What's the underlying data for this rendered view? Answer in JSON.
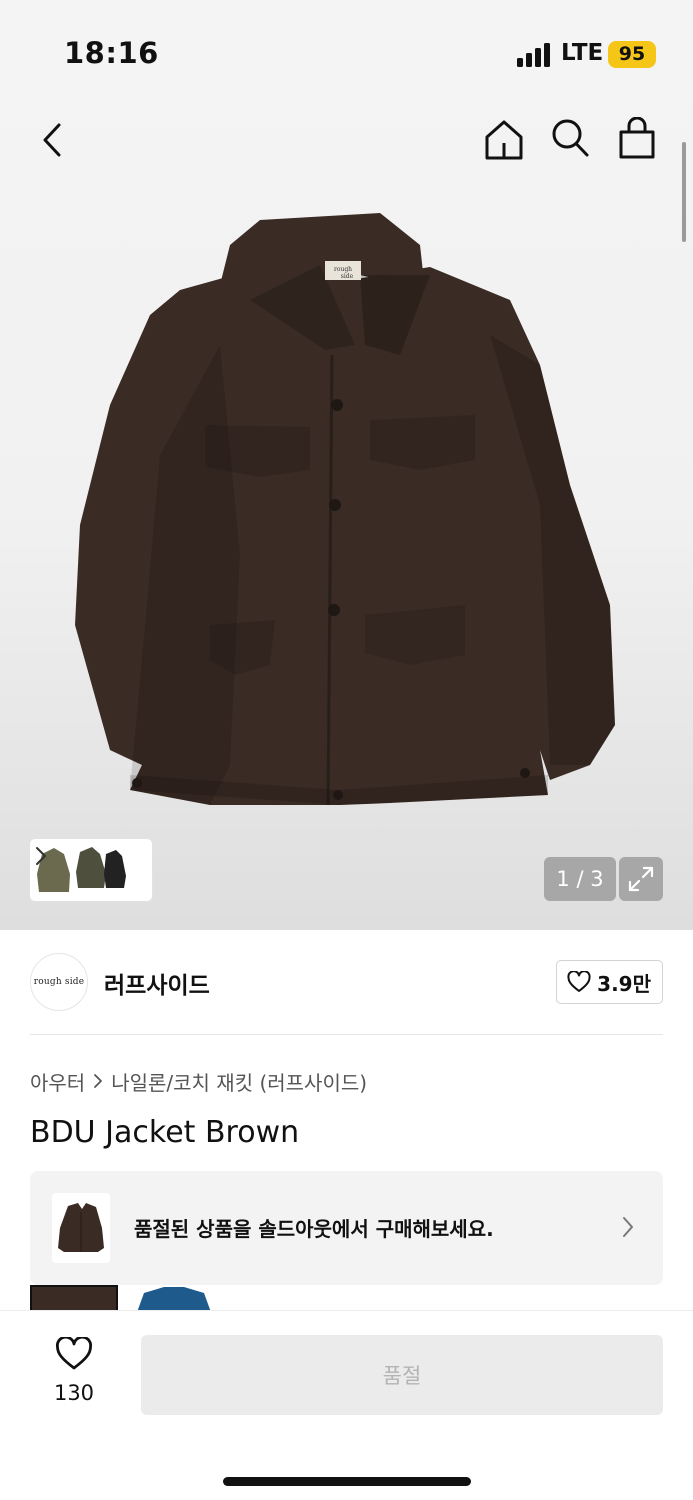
{
  "status_bar": {
    "time": "18:16",
    "network": "LTE",
    "battery": "95",
    "battery_color": "#f5c518"
  },
  "nav": {
    "back_icon": "chevron-left-icon",
    "home_icon": "home-icon",
    "search_icon": "search-icon",
    "bag_icon": "shopping-bag-icon"
  },
  "gallery": {
    "counter": "1 / 3",
    "jacket_color": "#3a2b24",
    "thumbnail_colors": [
      "#6b6a4e",
      "#4f4f3e",
      "#222222"
    ]
  },
  "brand": {
    "logo_text": "rough side",
    "name": "러프사이드",
    "like_count": "3.9만"
  },
  "product": {
    "breadcrumb": [
      "아우터",
      "나일론/코치 재킷 (러프사이드)"
    ],
    "title": "BDU Jacket Brown",
    "soldout_banner_text": "품절된 상품을 솔드아웃에서 구매해보세요."
  },
  "bottom_bar": {
    "wish_count": "130",
    "buy_button_label": "품절"
  }
}
